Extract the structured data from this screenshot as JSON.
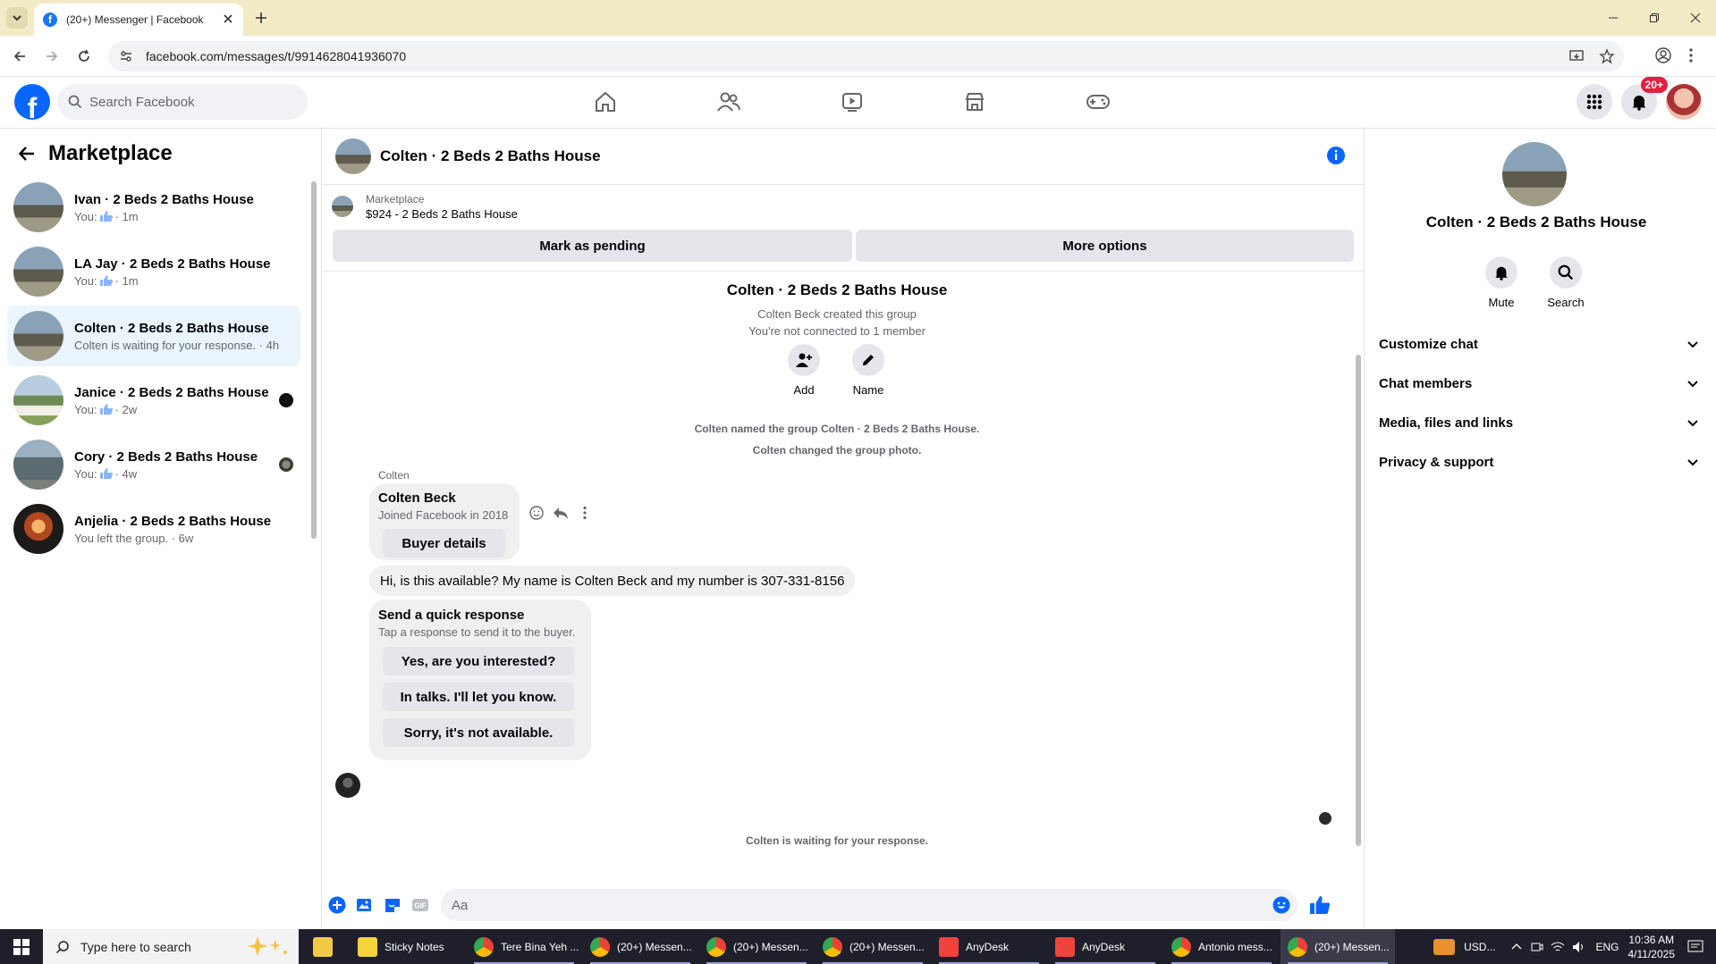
{
  "browser": {
    "tab_title": "(20+) Messenger | Facebook",
    "url": "facebook.com/messages/t/9914628041936070"
  },
  "fbnav": {
    "search_placeholder": "Search Facebook",
    "notification_badge": "20+",
    "nav_icons": [
      "home-icon",
      "friends-icon",
      "video-icon",
      "marketplace-icon",
      "gaming-icon"
    ]
  },
  "left": {
    "title": "Marketplace",
    "conversations": [
      {
        "name": "Ivan · 2 Beds 2 Baths House",
        "prefix": "You:",
        "time": "· 1m",
        "has_like": true
      },
      {
        "name": "LA Jay · 2 Beds 2 Baths House",
        "prefix": "You:",
        "time": "· 1m",
        "has_like": true
      },
      {
        "name": "Colten · 2 Beds 2 Baths House",
        "prefix": "Colten is waiting for your response.",
        "time": "· 4h",
        "has_like": false
      },
      {
        "name": "Janice · 2 Beds 2 Baths House",
        "prefix": "You:",
        "time": "· 2w",
        "has_like": true
      },
      {
        "name": "Cory · 2 Beds 2 Baths House",
        "prefix": "You:",
        "time": "· 4w",
        "has_like": true
      },
      {
        "name": "Anjelia · 2 Beds 2 Baths House",
        "prefix": "You left the group.",
        "time": "· 6w",
        "has_like": false
      }
    ]
  },
  "chat": {
    "title": "Colten · 2 Beds 2 Baths House",
    "listing_source": "Marketplace",
    "listing_detail": "$924 - 2 Beds 2 Baths House",
    "mark_pending": "Mark as pending",
    "more_options": "More options",
    "group_title": "Colten · 2 Beds 2 Baths House",
    "created_by": "Colten Beck created this group",
    "not_connected": "You're not connected to 1 member",
    "add_label": "Add",
    "name_label": "Name",
    "sys1": "Colten named the group Colten · 2 Beds 2 Baths House.",
    "sys2": "Colten changed the group photo.",
    "sender": "Colten",
    "profile_name": "Colten Beck",
    "profile_joined": "Joined Facebook in 2018",
    "buyer_details": "Buyer details",
    "message": "Hi, is this available? My name is Colten Beck and my number is 307-331-8156",
    "quick_title": "Send a quick response",
    "quick_sub": "Tap a response to send it to the buyer.",
    "quick_options": [
      "Yes, are you interested?",
      "In talks. I'll let you know.",
      "Sorry, it's not available."
    ],
    "waiting": "Colten is waiting for your response.",
    "composer_placeholder": "Aa"
  },
  "right": {
    "title": "Colten · 2 Beds 2 Baths House",
    "mute": "Mute",
    "search": "Search",
    "sections": [
      "Customize chat",
      "Chat members",
      "Media, files and links",
      "Privacy & support"
    ]
  },
  "taskbar": {
    "search_placeholder": "Type here to search",
    "items": [
      {
        "label": "Sticky Notes",
        "color": "#f7d33b"
      },
      {
        "label": "Tere Bina Yeh ...",
        "color": "#4285f4"
      },
      {
        "label": "(20+) Messen...",
        "color": "#4285f4"
      },
      {
        "label": "(20+) Messen...",
        "color": "#4285f4"
      },
      {
        "label": "(20+) Messen...",
        "color": "#4285f4"
      },
      {
        "label": "AnyDesk",
        "color": "#ef443b"
      },
      {
        "label": "AnyDesk",
        "color": "#ef443b"
      },
      {
        "label": "Antonio mess...",
        "color": "#4285f4"
      },
      {
        "label": "(20+) Messen...",
        "color": "#4285f4"
      }
    ],
    "currency": "USD...",
    "lang": "ENG",
    "time": "10:36 AM",
    "date": "4/11/2025"
  }
}
